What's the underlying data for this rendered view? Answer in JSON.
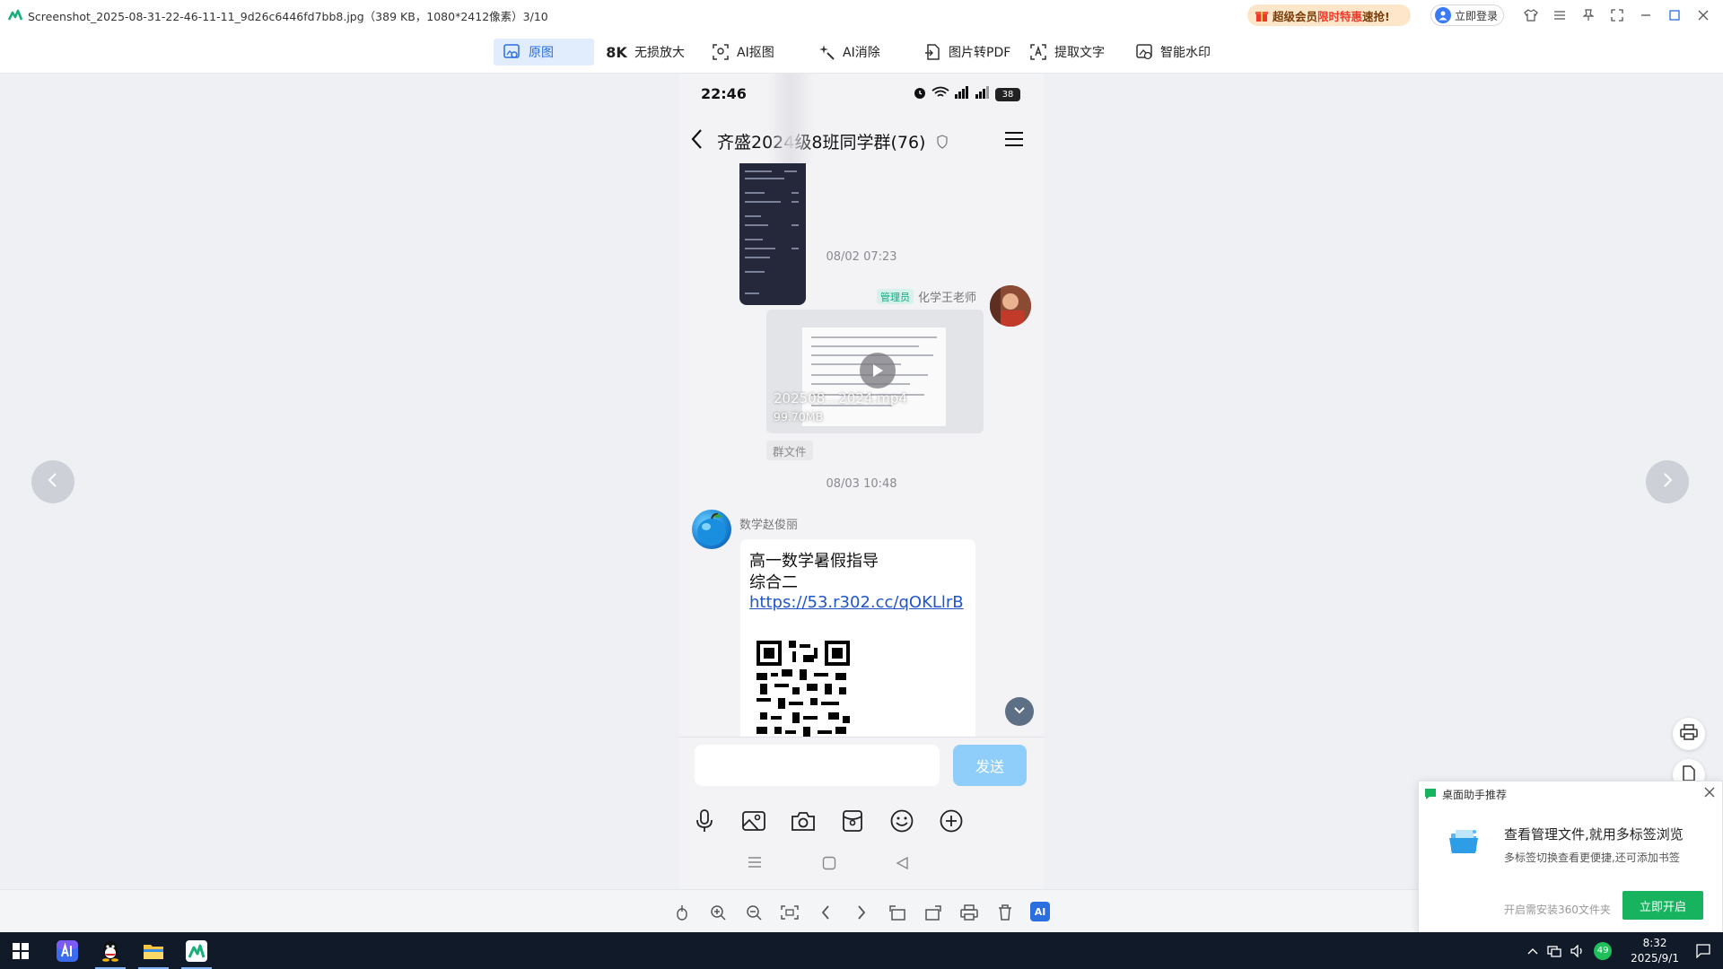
{
  "window": {
    "title": "Screenshot_2025-08-31-22-46-11-11_9d26c6446fd7bb8.jpg（389 KB，1080*2412像素）3/10",
    "promo": {
      "prefix": "超级会员",
      "highlight": "限时特惠",
      "suffix": "速抢!"
    },
    "login_label": "立即登录"
  },
  "toolbar": {
    "items": [
      {
        "label": "原图",
        "icon": "eye-image-icon",
        "active": true
      },
      {
        "label": "无损放大",
        "icon": "8k-icon"
      },
      {
        "label": "AI抠图",
        "icon": "cutout-icon"
      },
      {
        "label": "AI消除",
        "icon": "sparkle-eraser-icon"
      },
      {
        "label": "图片转PDF",
        "icon": "pdf-convert-icon"
      },
      {
        "label": "提取文字",
        "icon": "text-extract-icon"
      },
      {
        "label": "智能水印",
        "icon": "watermark-icon"
      }
    ],
    "eightk_glyph": "8K"
  },
  "phone": {
    "clock": "22:46",
    "battery": "38",
    "chat_title": "齐盛2024级8班同学群(76)",
    "timestamps": [
      "08/02 07:23",
      "08/03 10:48"
    ],
    "message1": {
      "badge": "管理员",
      "sender": "化学王老师",
      "video_name": "202508…2024.mp4",
      "video_size": "99.70MB",
      "tag": "群文件"
    },
    "message2": {
      "sender": "数学赵俊丽",
      "lines": [
        "高一数学暑假指导",
        "综合二"
      ],
      "link": "https://53.r302.cc/qOKLlrB"
    },
    "send_label": "发送"
  },
  "popup": {
    "header": "桌面助手推荐",
    "title": "查看管理文件,就用多标签浏览",
    "subtitle": "多标签切换查看更便捷,还可添加书签",
    "note": "开启需安装360文件夹",
    "button": "立即开启"
  },
  "viewer": {
    "ai_label": "AI"
  },
  "taskbar": {
    "time": "8:32",
    "date": "2025/9/1",
    "badge": "49",
    "apps": [
      "windows-start-icon",
      "ai-app-icon",
      "qq-icon",
      "file-explorer-icon",
      "image-viewer-icon"
    ]
  },
  "colors": {
    "accent": "#2a6ee0",
    "send_button": "#8fcdfb",
    "popup_button": "#17b35f",
    "link": "#2156c9"
  }
}
